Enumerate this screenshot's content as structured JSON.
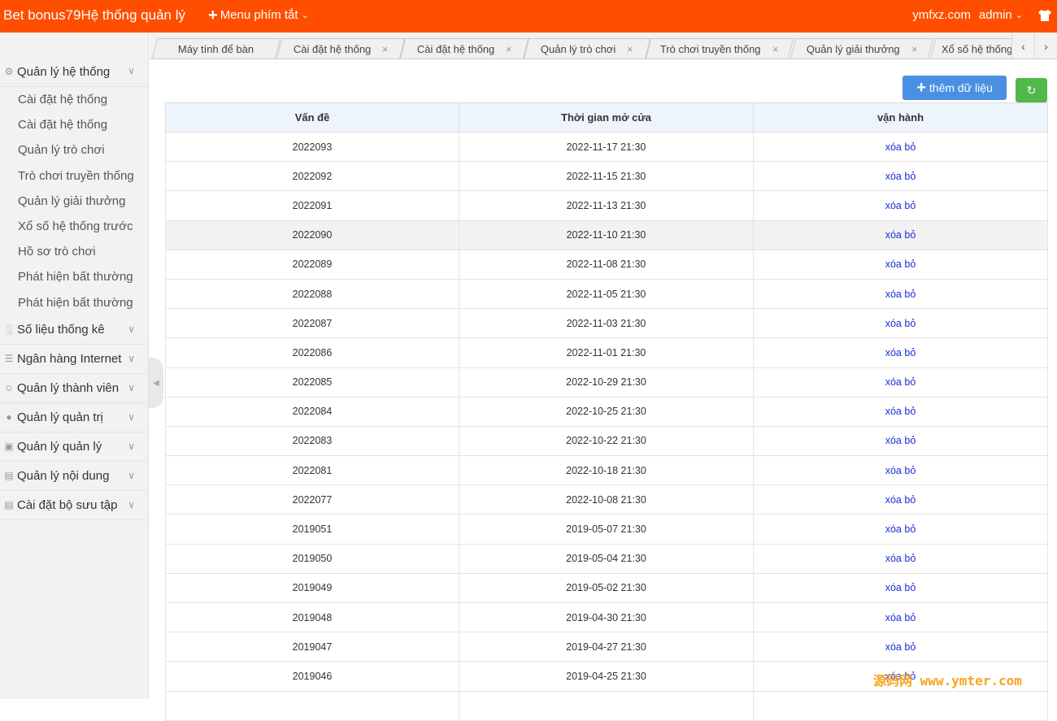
{
  "header": {
    "title": "Bet bonus79Hệ thống quản lý",
    "menu_label": "Menu phím tắt",
    "domain": "ymfxz.com",
    "user": "admin"
  },
  "sidebar": {
    "groups": [
      {
        "label": "Quản lý hệ thống",
        "icon": "gear-icon",
        "items": [
          "Cài đặt hệ thống",
          "Cài đặt hệ thống",
          "Quản lý trò chơi",
          "Trò chơi truyền thống",
          "Quản lý giải thưởng",
          "Xổ số hệ thống trước",
          "Hồ sơ trò chơi",
          "Phát hiện bất thường",
          "Phát hiện bất thường"
        ]
      },
      {
        "label": "Số liệu thống kê",
        "icon": "chart-icon"
      },
      {
        "label": "Ngân hàng Internet",
        "icon": "list-icon"
      },
      {
        "label": "Quản lý thành viên",
        "icon": "user-outline-icon"
      },
      {
        "label": "Quản lý quản trị",
        "icon": "user-icon"
      },
      {
        "label": "Quản lý quản lý",
        "icon": "gift-icon"
      },
      {
        "label": "Quản lý nội dung",
        "icon": "document-icon"
      },
      {
        "label": "Cài đặt bộ sưu tập",
        "icon": "document-icon"
      }
    ]
  },
  "tabs": [
    {
      "label": "Máy tính để bàn",
      "closable": false
    },
    {
      "label": "Cài đặt hệ thống",
      "closable": true
    },
    {
      "label": "Cài đặt hệ thống",
      "closable": true
    },
    {
      "label": "Quản lý trò chơi",
      "closable": true
    },
    {
      "label": "Trò chơi truyền thống",
      "closable": true
    },
    {
      "label": "Quản lý giải thưởng",
      "closable": true
    },
    {
      "label": "Xổ số hệ thống",
      "closable": false
    }
  ],
  "toolbar": {
    "add_label": "thêm dữ liệu"
  },
  "table": {
    "headers": [
      "Vấn đề",
      "Thời gian mở cửa",
      "vận hành"
    ],
    "action_label": "xóa bỏ",
    "rows": [
      [
        "2022093",
        "2022-11-17 21:30"
      ],
      [
        "2022092",
        "2022-11-15 21:30"
      ],
      [
        "2022091",
        "2022-11-13 21:30"
      ],
      [
        "2022090",
        "2022-11-10 21:30"
      ],
      [
        "2022089",
        "2022-11-08 21:30"
      ],
      [
        "2022088",
        "2022-11-05 21:30"
      ],
      [
        "2022087",
        "2022-11-03 21:30"
      ],
      [
        "2022086",
        "2022-11-01 21:30"
      ],
      [
        "2022085",
        "2022-10-29 21:30"
      ],
      [
        "2022084",
        "2022-10-25 21:30"
      ],
      [
        "2022083",
        "2022-10-22 21:30"
      ],
      [
        "2022081",
        "2022-10-18 21:30"
      ],
      [
        "2022077",
        "2022-10-08 21:30"
      ],
      [
        "2019051",
        "2019-05-07 21:30"
      ],
      [
        "2019050",
        "2019-05-04 21:30"
      ],
      [
        "2019049",
        "2019-05-02 21:30"
      ],
      [
        "2019048",
        "2019-04-30 21:30"
      ],
      [
        "2019047",
        "2019-04-27 21:30"
      ],
      [
        "2019046",
        "2019-04-25 21:30"
      ],
      [
        "",
        ""
      ]
    ]
  },
  "watermark": "源码网 www.ymter.com",
  "colors": {
    "header_bg": "#ff4e00",
    "add_button": "#4a90e2",
    "refresh_button": "#52b84a",
    "link": "#1a2ed6"
  }
}
